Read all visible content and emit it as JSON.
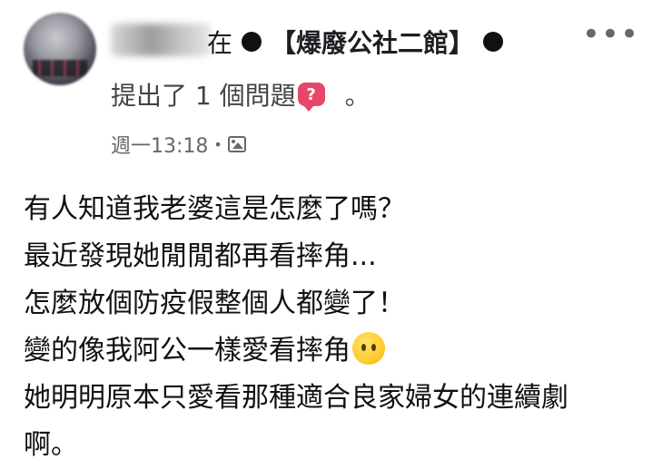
{
  "header": {
    "posted_in_text": "在",
    "group_name": "【爆廢公社二館】",
    "action_text": "提出了 1 個問題",
    "question_badge_icon": "question-badge-icon",
    "period": "。",
    "timestamp": "週一13:18",
    "separator": "•",
    "privacy_icon": "photo-icon",
    "more_label": "•••"
  },
  "post": {
    "lines": [
      "有人知道我老婆這是怎麼了嗎？",
      "最近發現她閒閒都再看摔角...",
      "怎麼放個防疫假整個人都變了！",
      "變的像我阿公一樣愛看摔角",
      "她明明原本只愛看那種適合良家婦女的連續劇",
      "啊。"
    ],
    "emoji_icon": "no-mouth-face-emoji"
  },
  "colors": {
    "badge": "#e8456b",
    "meta_text": "#65676b",
    "text": "#111111"
  }
}
